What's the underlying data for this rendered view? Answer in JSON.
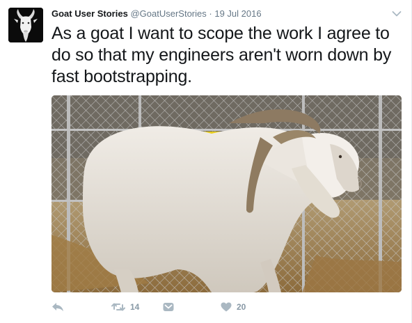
{
  "tweet": {
    "display_name": "Goat User Stories",
    "handle": "@GoatUserStories",
    "separator": "·",
    "date": "19 Jul 2016",
    "text": "As a goat I want to scope the work I agree to do so that my engineers aren't worn down by fast bootstrapping.",
    "media_icon": "goat-photo",
    "avatar_icon": "goat-head-icon"
  },
  "actions": {
    "reply_icon": "reply-icon",
    "retweet_icon": "retweet-icon",
    "retweet_count": "14",
    "dm_icon": "direct-message-icon",
    "like_icon": "heart-icon",
    "like_count": "20"
  },
  "colors": {
    "text": "#14171a",
    "secondary": "#657786",
    "action": "#aab8c2"
  }
}
